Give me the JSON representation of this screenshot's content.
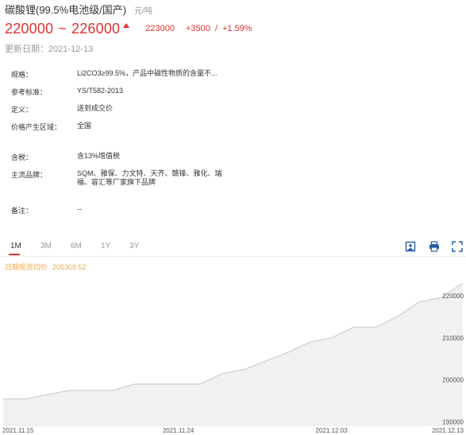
{
  "header": {
    "title": "碳酸锂(99.5%电池级/国产)",
    "unit": "元/吨",
    "price_low": "220000",
    "tilde": "~",
    "price_high": "226000",
    "price_now": "223000",
    "change": "+3500",
    "change_sep": "/",
    "change_pct": "+1.59%",
    "update_label": "更新日期：",
    "update_date": "2021-12-13",
    "up_color": "#e0332e"
  },
  "spec": [
    {
      "label": "规格：",
      "value": "Li2CO3≥99.5%，产品中磁性物质的含量不..."
    },
    {
      "label": "参考标准：",
      "value": "YS/T582-2013"
    },
    {
      "label": "定义：",
      "value": "送到成交价"
    },
    {
      "label": "价格产生区域：",
      "value": "全国"
    },
    {
      "label": "含税：",
      "value": "含13%增值税"
    },
    {
      "label": "主流品牌：",
      "value": "SQM、雅保、力文特、天齐、赣锋、雅化、瑞福、容汇等厂家旗下品牌"
    },
    {
      "label": "备注：",
      "value": "--"
    }
  ],
  "tabs": [
    {
      "label": "1M",
      "active": true
    },
    {
      "label": "3M",
      "active": false
    },
    {
      "label": "6M",
      "active": false
    },
    {
      "label": "1Y",
      "active": false
    },
    {
      "label": "3Y",
      "active": false
    }
  ],
  "toolbar": {
    "icons": [
      "image-icon",
      "print-icon",
      "fullscreen-icon"
    ]
  },
  "legend": {
    "label": "日期现货均价",
    "value": "205309.52",
    "color": "#f4a64e"
  },
  "chart_data": {
    "type": "area",
    "x": [
      "2021-11-13",
      "2021-11-15",
      "2021-11-16",
      "2021-11-17",
      "2021-11-18",
      "2021-11-19",
      "2021-11-22",
      "2021-11-23",
      "2021-11-24",
      "2021-11-25",
      "2021-11-26",
      "2021-11-29",
      "2021-11-30",
      "2021-12-01",
      "2021-12-02",
      "2021-12-03",
      "2021-12-06",
      "2021-12-07",
      "2021-12-08",
      "2021-12-09",
      "2021-12-10",
      "2021-12-13"
    ],
    "values": [
      195500,
      195500,
      196500,
      197500,
      197500,
      197500,
      199000,
      199000,
      199000,
      199000,
      201500,
      202500,
      204500,
      206500,
      209000,
      210000,
      212500,
      212500,
      215000,
      218500,
      219500,
      223000
    ],
    "xtick_labels": [
      "2021.11.15",
      "2021.11.24",
      "2021.12.03",
      "2021.12.13"
    ],
    "xtick_index": [
      1,
      8,
      15,
      21
    ],
    "yticks": [
      190000,
      200000,
      210000,
      220000
    ],
    "ylim": [
      189000,
      226000
    ],
    "line_color": "#cfcfcf",
    "fill_color": "#f1f1f1",
    "grid": false
  }
}
